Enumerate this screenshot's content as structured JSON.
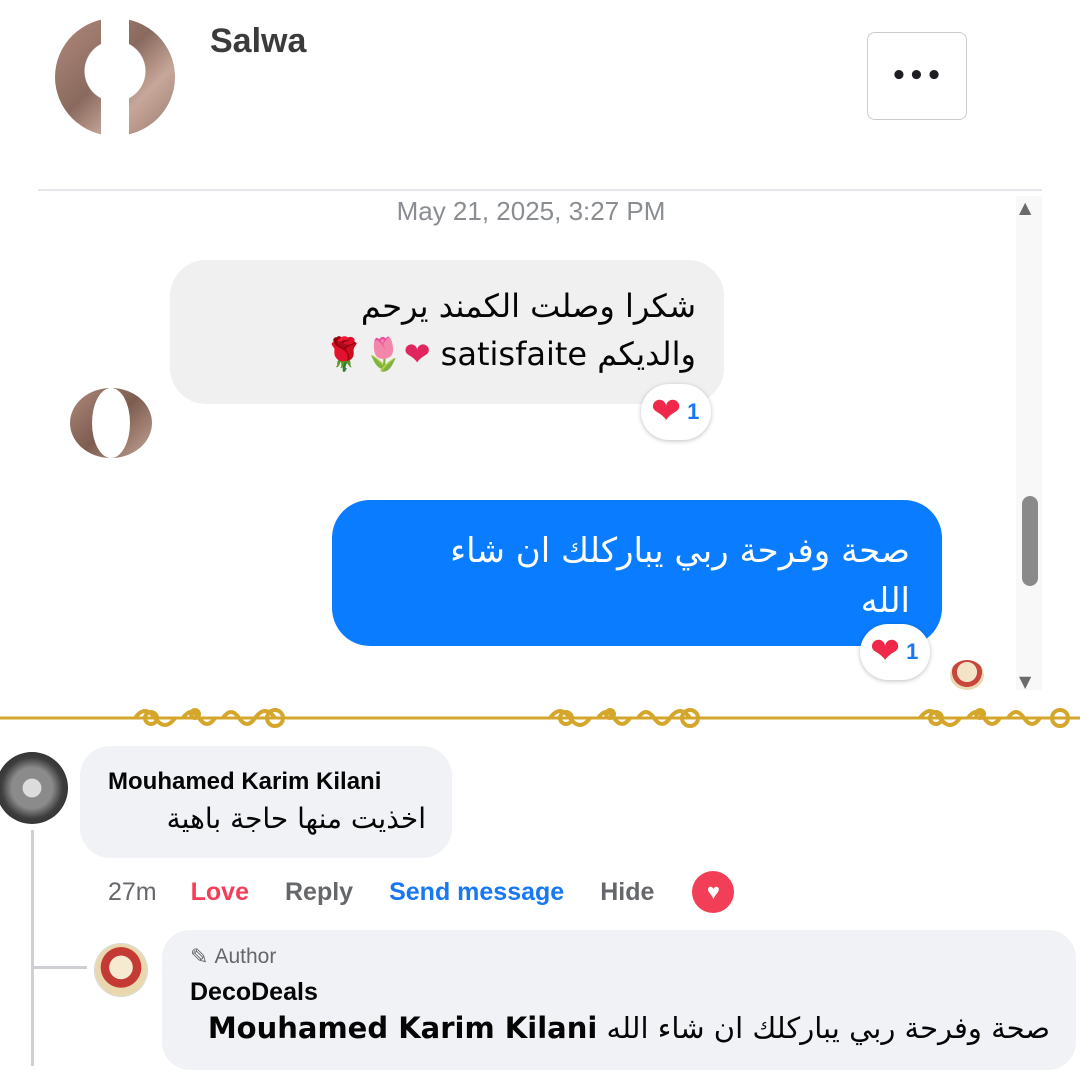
{
  "chat": {
    "contact_name": "Salwa",
    "more_label": "•••",
    "timestamp": "May 21, 2025, 3:27 PM",
    "incoming": {
      "line1": "شكرا وصلت الكمند يرحم",
      "line2_text": "والديكم satisfaite",
      "line2_emojis": "❤🌷🌹",
      "reaction_emoji": "❤",
      "reaction_count": "1"
    },
    "outgoing": {
      "line1": "صحة وفرحة ربي يباركلك ان شاء",
      "line2": "الله",
      "reaction_emoji": "❤",
      "reaction_count": "1"
    }
  },
  "comments": {
    "comment": {
      "author": "Mouhamed Karim Kilani",
      "text": "اخذيت منها حاجة باهية",
      "time": "27m",
      "love_label": "Love",
      "reply_label": "Reply",
      "send_message_label": "Send message",
      "hide_label": "Hide",
      "reaction_icon": "♥"
    },
    "reply": {
      "badge_icon": "✎",
      "badge_label": "Author",
      "author": "DecoDeals",
      "mention": "Mouhamed Karim Kilani",
      "text": "صحة وفرحة ربي يباركلك ان شاء الله"
    }
  },
  "colors": {
    "outgoing_bubble": "#0a7cff",
    "incoming_bubble": "#f0f0f0",
    "love": "#f33e58",
    "link_blue": "#1877f2",
    "ornament_gold": "#d4a72c"
  }
}
